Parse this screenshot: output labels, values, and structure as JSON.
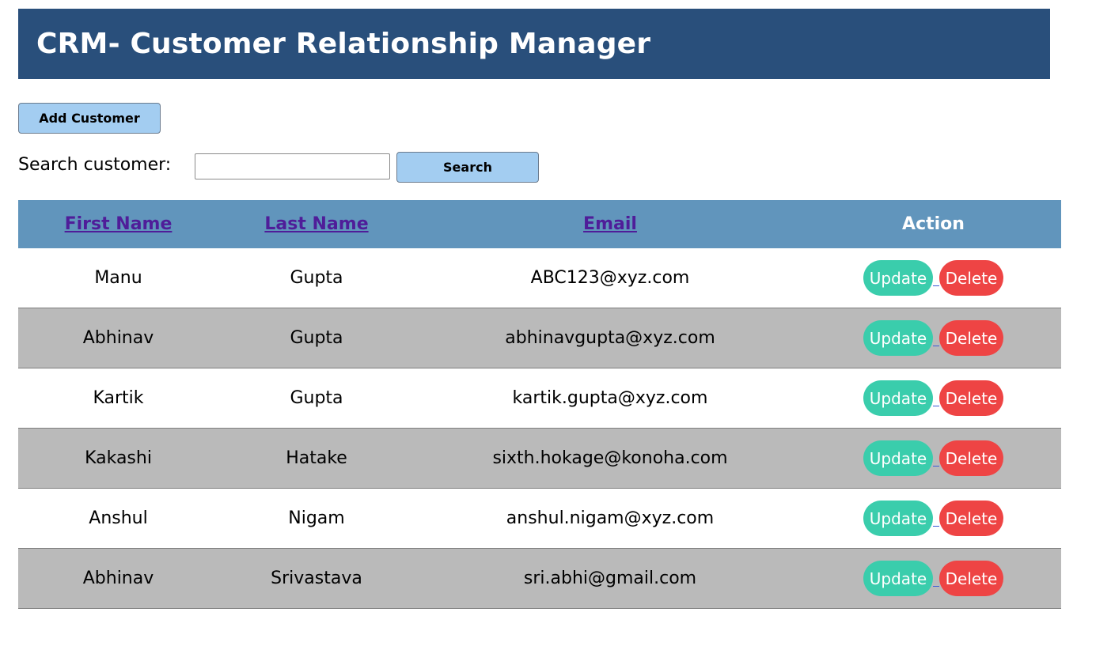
{
  "header": {
    "title": "CRM- Customer Relationship Manager"
  },
  "toolbar": {
    "add_label": "Add Customer"
  },
  "search": {
    "label": "Search customer:",
    "value": "",
    "button_label": "Search"
  },
  "table": {
    "columns": [
      "First Name",
      "Last Name",
      "Email",
      "Action"
    ],
    "rows": [
      {
        "first": "Manu",
        "last": "Gupta",
        "email": "ABC123@xyz.com"
      },
      {
        "first": "Abhinav",
        "last": "Gupta",
        "email": "abhinavgupta@xyz.com"
      },
      {
        "first": "Kartik",
        "last": "Gupta",
        "email": "kartik.gupta@xyz.com"
      },
      {
        "first": "Kakashi",
        "last": "Hatake",
        "email": "sixth.hokage@konoha.com"
      },
      {
        "first": "Anshul",
        "last": "Nigam",
        "email": "anshul.nigam@xyz.com"
      },
      {
        "first": "Abhinav",
        "last": "Srivastava",
        "email": "sri.abhi@gmail.com"
      }
    ],
    "update_label": "Update",
    "delete_label": "Delete"
  },
  "colors": {
    "header_bg": "#294f7b",
    "table_header_bg": "#6195bc",
    "button_bg": "#a3cdf1",
    "update_bg": "#3acdac",
    "delete_bg": "#ee4444",
    "alt_row_bg": "#bababa",
    "sort_link": "#4f1d99"
  }
}
